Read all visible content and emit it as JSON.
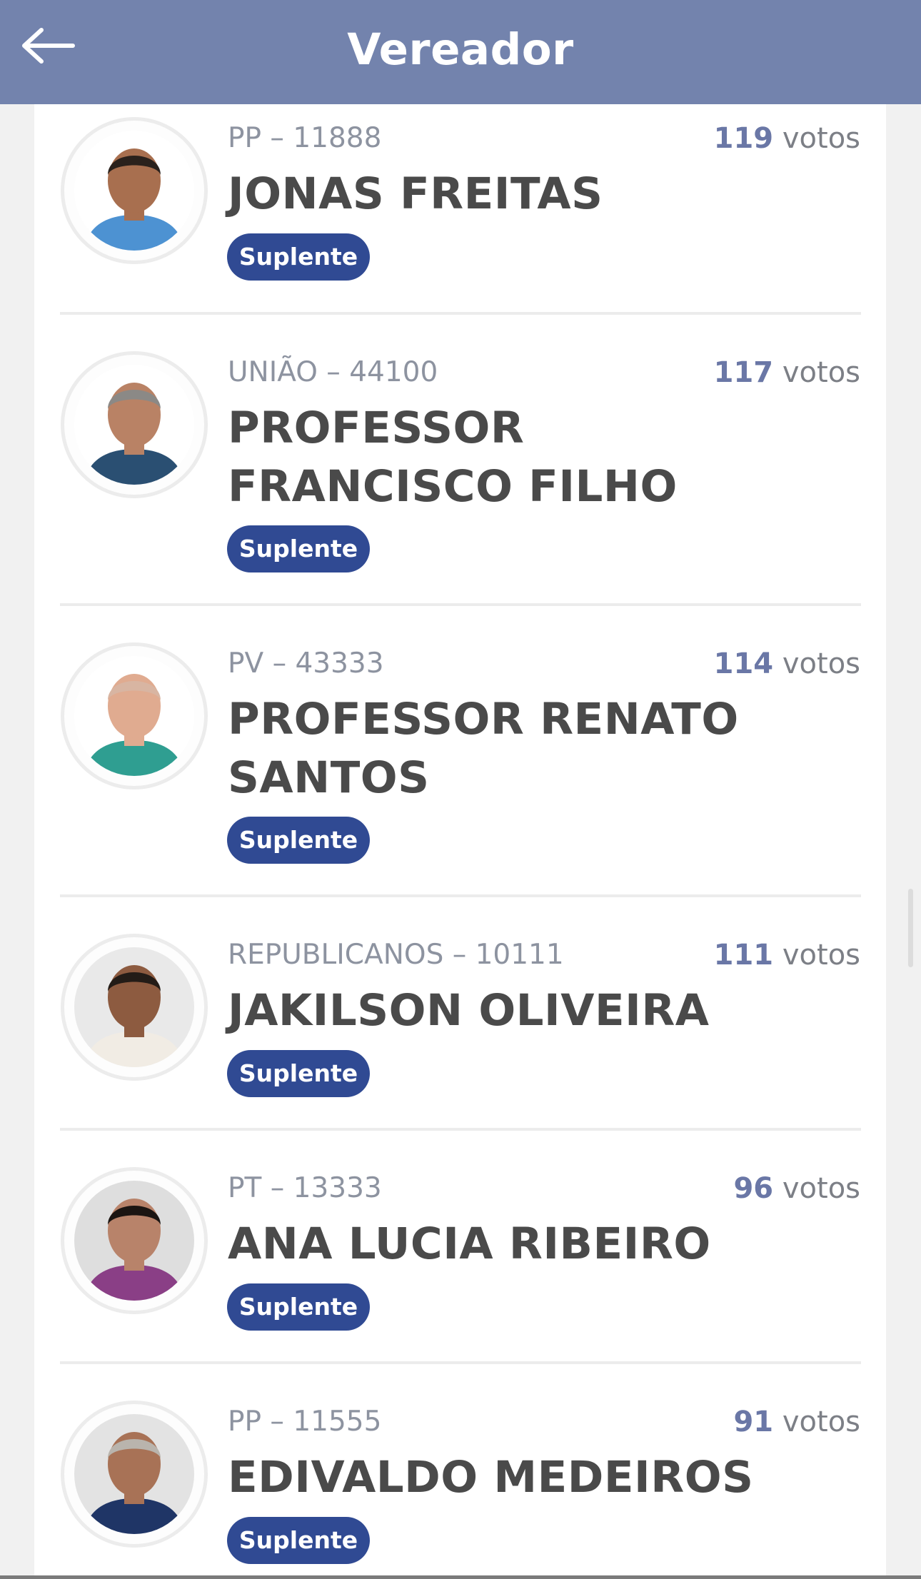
{
  "header": {
    "title": "Vereador",
    "back_icon": "arrow-left-icon",
    "background_color": "#7383ad"
  },
  "candidates": [
    {
      "party": "PP – 11888",
      "name": "JONAS FREITAS",
      "votes_number": "119",
      "votes_label": "votos",
      "status": "Suplente",
      "photo_icon": "candidate-photo",
      "photo_colors": {
        "bg": "#ffffff",
        "skin": "#a86f4f",
        "hair": "#2a211c",
        "shirt": "#4d92d2"
      }
    },
    {
      "party": "UNIÃO – 44100",
      "name": "PROFESSOR FRANCISCO FILHO",
      "votes_number": "117",
      "votes_label": "votos",
      "status": "Suplente",
      "photo_icon": "candidate-photo",
      "photo_colors": {
        "bg": "#ffffff",
        "skin": "#b98265",
        "hair": "#8b8986",
        "shirt": "#2a4f72"
      }
    },
    {
      "party": "PV – 43333",
      "name": "PROFESSOR RENATO SANTOS",
      "votes_number": "114",
      "votes_label": "votos",
      "status": "Suplente",
      "photo_icon": "candidate-photo",
      "photo_colors": {
        "bg": "#ffffff",
        "skin": "#e0ab90",
        "hair": "#d8b5a2",
        "shirt": "#2f9e91"
      }
    },
    {
      "party": "REPUBLICANOS – 10111",
      "name": "JAKILSON OLIVEIRA",
      "votes_number": "111",
      "votes_label": "votos",
      "status": "Suplente",
      "photo_icon": "candidate-photo",
      "photo_colors": {
        "bg": "#e9e9e9",
        "skin": "#8d5b40",
        "hair": "#231c17",
        "shirt": "#f1ece4"
      }
    },
    {
      "party": "PT – 13333",
      "name": "ANA LUCIA RIBEIRO",
      "votes_number": "96",
      "votes_label": "votos",
      "status": "Suplente",
      "photo_icon": "candidate-photo",
      "photo_colors": {
        "bg": "#dedede",
        "skin": "#b8836a",
        "hair": "#1b1512",
        "shirt": "#8a3f86"
      }
    },
    {
      "party": "PP – 11555",
      "name": "EDIVALDO MEDEIROS",
      "votes_number": "91",
      "votes_label": "votos",
      "status": "Suplente",
      "photo_icon": "candidate-photo",
      "photo_colors": {
        "bg": "#e3e3e3",
        "skin": "#a87256",
        "hair": "#b9b4ad",
        "shirt": "#1f3566"
      }
    }
  ]
}
